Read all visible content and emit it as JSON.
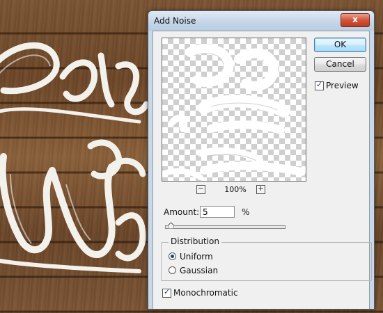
{
  "dialog": {
    "title": "Add Noise",
    "close_label": "x",
    "ok_label": "OK",
    "cancel_label": "Cancel",
    "preview_label": "Preview",
    "preview_checked": true,
    "zoom": {
      "zoom_out_label": "−",
      "zoom_in_label": "+",
      "level": "100%"
    },
    "amount": {
      "label": "Amount:",
      "value": "5",
      "unit": "%",
      "slider_fraction": 0.05
    },
    "distribution": {
      "label": "Distribution",
      "options": [
        "Uniform",
        "Gaussian"
      ],
      "selected": "Uniform"
    },
    "monochromatic_label": "Monochromatic",
    "monochromatic_checked": true
  },
  "icons": {
    "check": "✓",
    "close": "close-icon",
    "zoom_out": "minus-icon",
    "zoom_in": "plus-icon"
  },
  "colors": {
    "wood": "#6b4a2c",
    "dialog_frame": "#c9d8e8",
    "close_button": "#c0391e",
    "accent": "#1c3e76"
  }
}
